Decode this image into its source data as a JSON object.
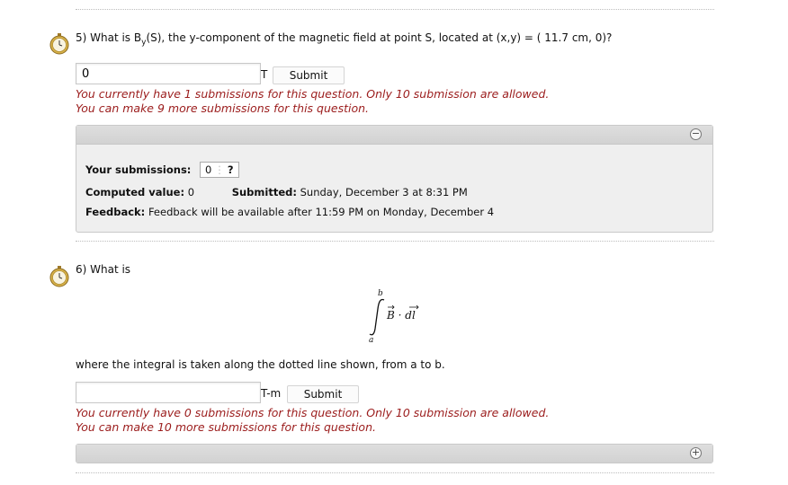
{
  "q5": {
    "number": "5) What is ",
    "symbol_main": "B",
    "symbol_sub": "y",
    "question_rest": "(S), the y-component of the magnetic field at point S, located at (x,y) = ( 11.7 cm, 0)?",
    "input_value": "0",
    "unit": "T",
    "submit_label": "Submit",
    "notice_line1": "You currently have 1 submissions for this question. Only 10 submission are allowed.",
    "notice_line2": "You can make 9 more submissions for this question.",
    "panel": {
      "toggle_icon": "minus-circle-icon",
      "toggle_glyph": "−",
      "your_submissions_label": "Your submissions:",
      "submission_value": "0",
      "submission_hint": "?",
      "computed_label": "Computed value:",
      "computed_value": "0",
      "submitted_label": "Submitted:",
      "submitted_value": "Sunday, December 3 at 8:31 PM",
      "feedback_label": "Feedback:",
      "feedback_value": "Feedback will be available after 11:59 PM on Monday, December 4"
    }
  },
  "q6": {
    "question": "6) What is",
    "integral_upper": "b",
    "integral_lower": "a",
    "integrand": "B · dl",
    "followup": "where the integral is taken along the dotted line shown, from a to b.",
    "input_value": "",
    "unit": "T-m",
    "submit_label": "Submit",
    "notice_line1": "You currently have 0 submissions for this question. Only 10 submission are allowed.",
    "notice_line2": "You can make 10 more submissions for this question.",
    "panel": {
      "toggle_icon": "plus-circle-icon",
      "toggle_glyph": "+"
    }
  },
  "colors": {
    "notice": "#9b1c1c",
    "panel_bg": "#efefef",
    "panel_border": "#c9c9c9"
  }
}
